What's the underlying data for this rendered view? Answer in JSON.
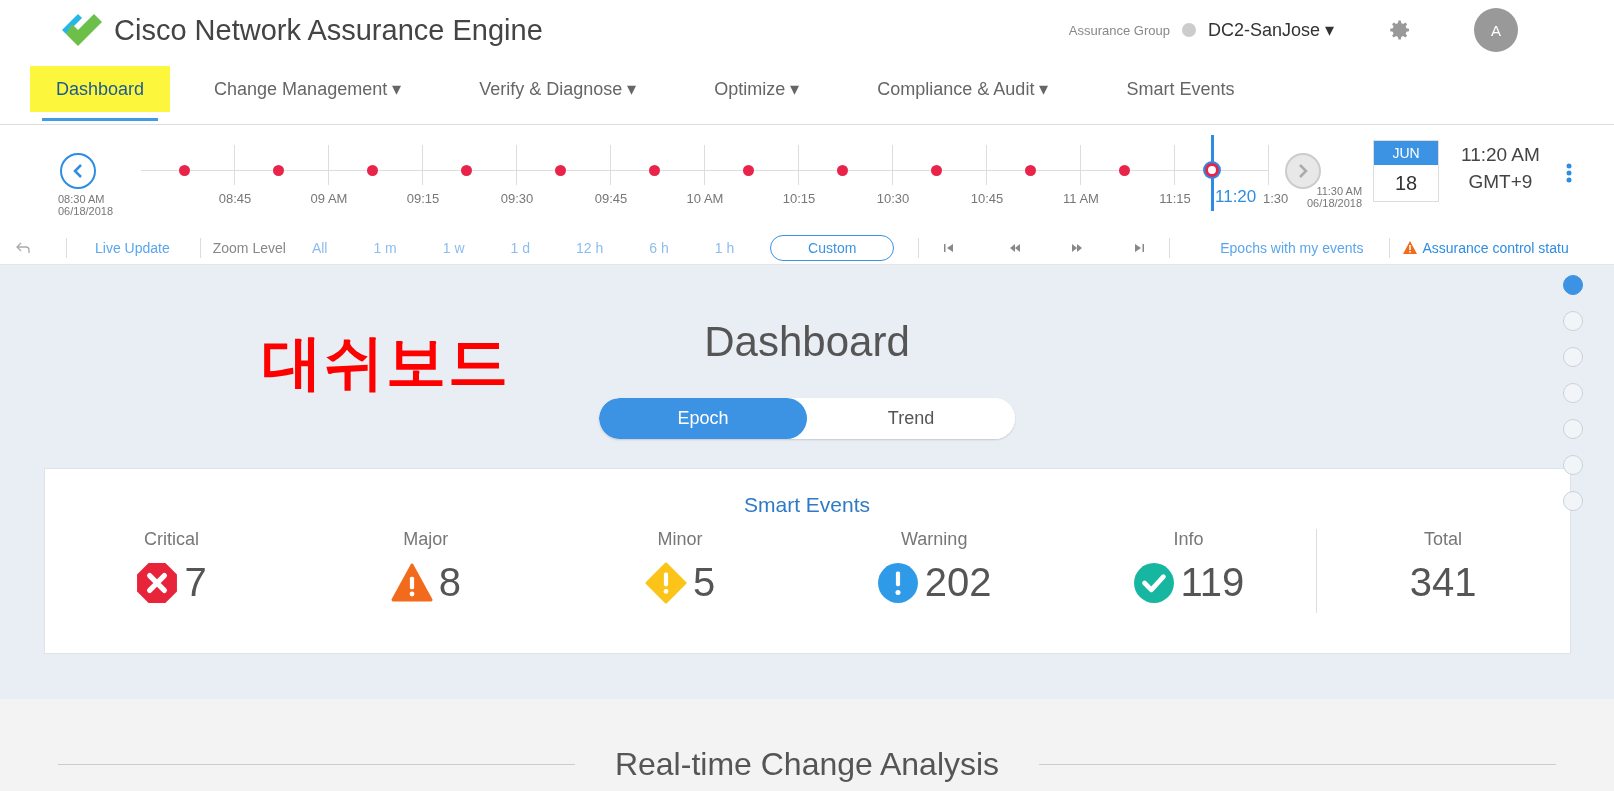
{
  "app": {
    "title": "Cisco Network Assurance Engine"
  },
  "assurance_group": {
    "label": "Assurance Group",
    "value": "DC2-SanJose ▾"
  },
  "avatar": "A",
  "nav": [
    {
      "label": "Dashboard",
      "selected": true
    },
    {
      "label": "Change Management ▾",
      "selected": false
    },
    {
      "label": "Verify & Diagnose ▾",
      "selected": false
    },
    {
      "label": "Optimize ▾",
      "selected": false
    },
    {
      "label": "Compliance & Audit ▾",
      "selected": false
    },
    {
      "label": "Smart Events",
      "selected": false
    }
  ],
  "timeline": {
    "start_time": "08:30 AM",
    "start_date": "06/18/2018",
    "segments": [
      {
        "tick": "08:45",
        "selected": false
      },
      {
        "tick": "09 AM",
        "selected": false
      },
      {
        "tick": "09:15",
        "selected": false
      },
      {
        "tick": "09:30",
        "selected": false
      },
      {
        "tick": "09:45",
        "selected": false
      },
      {
        "tick": "10 AM",
        "selected": false
      },
      {
        "tick": "10:15",
        "selected": false
      },
      {
        "tick": "10:30",
        "selected": false
      },
      {
        "tick": "10:45",
        "selected": false
      },
      {
        "tick": "11 AM",
        "selected": false
      },
      {
        "tick": "11:15",
        "selected": false
      },
      {
        "tick": "1:30",
        "selected": true
      }
    ],
    "marker": "11:20",
    "end_time": "11:30 AM",
    "end_date": "06/18/2018"
  },
  "date": {
    "month": "JUN",
    "day": "18",
    "time": "11:20 AM",
    "zone": "GMT+9"
  },
  "toolbar": {
    "live_update": "Live Update",
    "zoom_label": "Zoom Level",
    "zoom_levels": [
      {
        "label": "All",
        "selected": false
      },
      {
        "label": "1 m",
        "selected": false
      },
      {
        "label": "1 w",
        "selected": false
      },
      {
        "label": "1 d",
        "selected": false
      },
      {
        "label": "12 h",
        "selected": false
      },
      {
        "label": "6 h",
        "selected": false
      },
      {
        "label": "1 h",
        "selected": false
      },
      {
        "label": "Custom",
        "selected": true
      }
    ],
    "epochs": "Epochs with my events",
    "status": "Assurance control statu"
  },
  "annotation": "대쉬보드",
  "page_title": "Dashboard",
  "view_toggle": [
    {
      "label": "Epoch",
      "selected": true
    },
    {
      "label": "Trend",
      "selected": false
    }
  ],
  "smart_events": {
    "title": "Smart Events",
    "counts": [
      {
        "kind": "critical",
        "label": "Critical",
        "value": "7"
      },
      {
        "kind": "major",
        "label": "Major",
        "value": "8"
      },
      {
        "kind": "minor",
        "label": "Minor",
        "value": "5"
      },
      {
        "kind": "warning",
        "label": "Warning",
        "value": "202"
      },
      {
        "kind": "info",
        "label": "Info",
        "value": "119"
      }
    ],
    "total": {
      "label": "Total",
      "value": "341"
    }
  },
  "section_nav": [
    {
      "selected": true
    },
    {
      "selected": false
    },
    {
      "selected": false
    },
    {
      "selected": false
    },
    {
      "selected": false
    },
    {
      "selected": false
    },
    {
      "selected": false
    }
  ],
  "section_title": "Real-time Change Analysis"
}
